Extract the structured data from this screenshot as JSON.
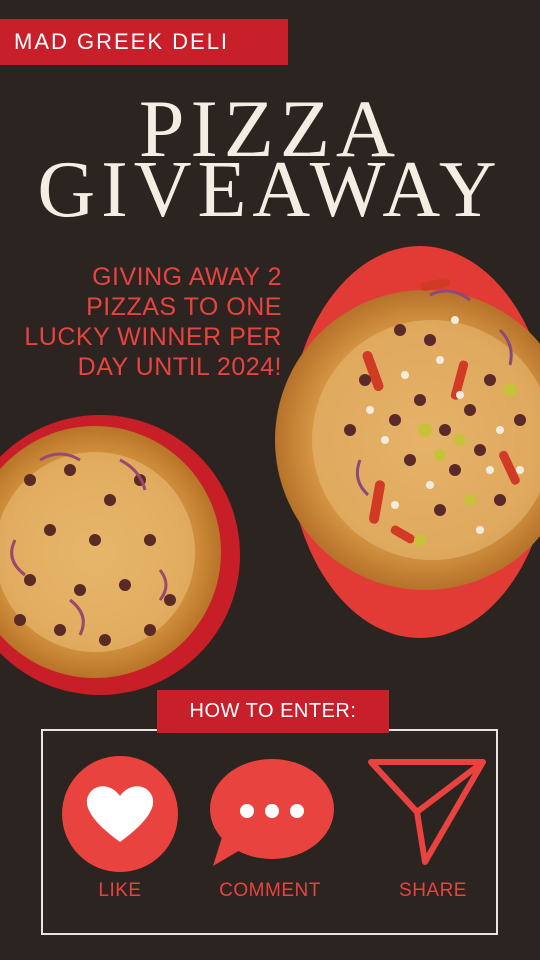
{
  "brand": {
    "name": "MAD GREEK DELI"
  },
  "headline": {
    "line1": "PIZZA",
    "line2": "GIVEAWAY"
  },
  "tagline": {
    "lines": [
      "GIVING AWAY 2",
      "PIZZAS TO ONE",
      "LUCKY WINNER PER",
      "DAY UNTIL 2024!"
    ]
  },
  "how_to_enter": {
    "label": "HOW TO ENTER:",
    "actions": [
      {
        "label": "LIKE",
        "icon": "heart-icon"
      },
      {
        "label": "COMMENT",
        "icon": "speech-bubble-icon"
      },
      {
        "label": "SHARE",
        "icon": "paper-plane-icon"
      }
    ]
  },
  "colors": {
    "background": "#2c2420",
    "accent_red": "#c8202a",
    "text_red": "#e8433f",
    "title_cream": "#f4ede4"
  }
}
